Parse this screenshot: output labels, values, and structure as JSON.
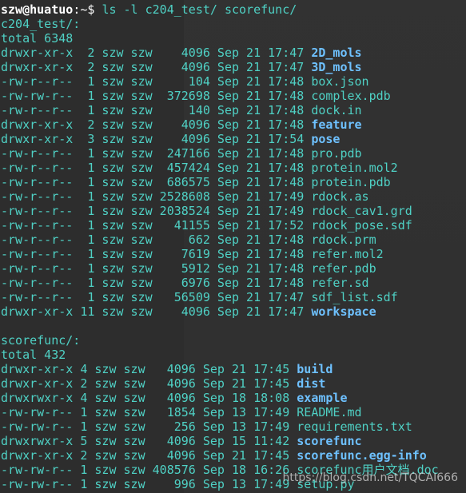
{
  "prompt": {
    "user_host": "szw@huatuo",
    "path": ":~$ ",
    "command": "ls -l c204_test/ scorefunc/"
  },
  "dir1": {
    "header": "c204_test/:",
    "total": "total 6348",
    "rows": [
      {
        "meta": "drwxr-xr-x  2 szw szw    4096 Sep 21 17:47 ",
        "name": "2D_mols",
        "is_dir": true
      },
      {
        "meta": "drwxr-xr-x  2 szw szw    4096 Sep 21 17:47 ",
        "name": "3D_mols",
        "is_dir": true
      },
      {
        "meta": "-rw-r--r--  1 szw szw     104 Sep 21 17:48 ",
        "name": "box.json",
        "is_dir": false
      },
      {
        "meta": "-rw-rw-r--  1 szw szw  372698 Sep 21 17:48 ",
        "name": "complex.pdb",
        "is_dir": false
      },
      {
        "meta": "-rw-r--r--  1 szw szw     140 Sep 21 17:48 ",
        "name": "dock.in",
        "is_dir": false
      },
      {
        "meta": "drwxr-xr-x  2 szw szw    4096 Sep 21 17:48 ",
        "name": "feature",
        "is_dir": true
      },
      {
        "meta": "drwxr-xr-x  3 szw szw    4096 Sep 21 17:54 ",
        "name": "pose",
        "is_dir": true
      },
      {
        "meta": "-rw-r--r--  1 szw szw  247166 Sep 21 17:48 ",
        "name": "pro.pdb",
        "is_dir": false
      },
      {
        "meta": "-rw-r--r--  1 szw szw  457424 Sep 21 17:48 ",
        "name": "protein.mol2",
        "is_dir": false
      },
      {
        "meta": "-rw-r--r--  1 szw szw  686575 Sep 21 17:48 ",
        "name": "protein.pdb",
        "is_dir": false
      },
      {
        "meta": "-rw-r--r--  1 szw szw 2528608 Sep 21 17:49 ",
        "name": "rdock.as",
        "is_dir": false
      },
      {
        "meta": "-rw-r--r--  1 szw szw 2038524 Sep 21 17:49 ",
        "name": "rdock_cav1.grd",
        "is_dir": false
      },
      {
        "meta": "-rw-r--r--  1 szw szw   41155 Sep 21 17:52 ",
        "name": "rdock_pose.sdf",
        "is_dir": false
      },
      {
        "meta": "-rw-r--r--  1 szw szw     662 Sep 21 17:48 ",
        "name": "rdock.prm",
        "is_dir": false
      },
      {
        "meta": "-rw-r--r--  1 szw szw    7619 Sep 21 17:48 ",
        "name": "refer.mol2",
        "is_dir": false
      },
      {
        "meta": "-rw-r--r--  1 szw szw    5912 Sep 21 17:48 ",
        "name": "refer.pdb",
        "is_dir": false
      },
      {
        "meta": "-rw-r--r--  1 szw szw    6976 Sep 21 17:48 ",
        "name": "refer.sd",
        "is_dir": false
      },
      {
        "meta": "-rw-r--r--  1 szw szw   56509 Sep 21 17:47 ",
        "name": "sdf_list.sdf",
        "is_dir": false
      },
      {
        "meta": "drwxr-xr-x 11 szw szw    4096 Sep 21 17:47 ",
        "name": "workspace",
        "is_dir": true
      }
    ]
  },
  "dir2": {
    "header": "scorefunc/:",
    "total": "total 432",
    "rows": [
      {
        "meta": "drwxr-xr-x 4 szw szw   4096 Sep 21 17:45 ",
        "name": "build",
        "is_dir": true
      },
      {
        "meta": "drwxr-xr-x 2 szw szw   4096 Sep 21 17:45 ",
        "name": "dist",
        "is_dir": true
      },
      {
        "meta": "drwxrwxr-x 4 szw szw   4096 Sep 18 18:08 ",
        "name": "example",
        "is_dir": true
      },
      {
        "meta": "-rw-rw-r-- 1 szw szw   1854 Sep 13 17:49 ",
        "name": "README.md",
        "is_dir": false
      },
      {
        "meta": "-rw-rw-r-- 1 szw szw    256 Sep 13 17:49 ",
        "name": "requirements.txt",
        "is_dir": false
      },
      {
        "meta": "drwxrwxr-x 5 szw szw   4096 Sep 15 11:42 ",
        "name": "scorefunc",
        "is_dir": true
      },
      {
        "meta": "drwxr-xr-x 2 szw szw   4096 Sep 21 17:45 ",
        "name": "scorefunc.egg-info",
        "is_dir": true
      },
      {
        "meta": "-rw-rw-r-- 1 szw szw 408576 Sep 18 16:26 ",
        "name": "scorefunc用户文档.doc",
        "is_dir": false
      },
      {
        "meta": "-rw-rw-r-- 1 szw szw    996 Sep 13 17:49 ",
        "name": "setup.py",
        "is_dir": false
      }
    ]
  },
  "watermark": "https://blog.csdn.net/TQCAI666",
  "colors": {
    "background": "#2d2d2d",
    "file_text": "#4fd1c5",
    "dir_text": "#6ec1ff",
    "prompt": "#ffffff"
  }
}
